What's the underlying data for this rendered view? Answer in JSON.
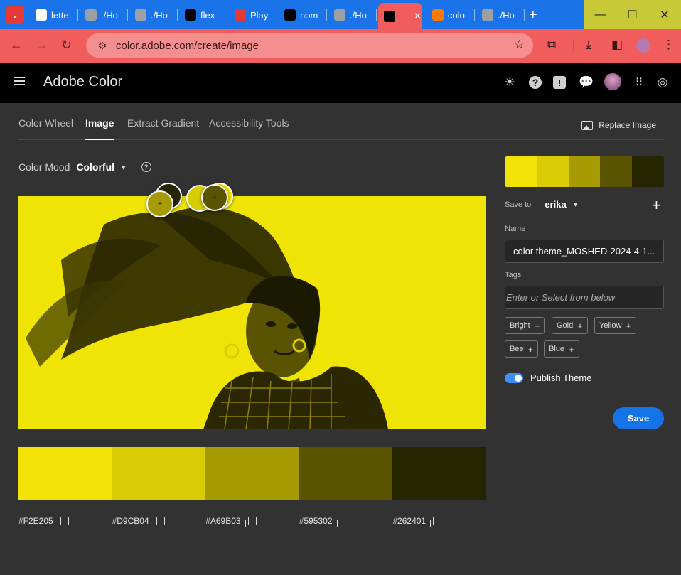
{
  "browser": {
    "tabs": [
      {
        "label": "lette",
        "icon": "lettering-icon",
        "color": "#ffffff"
      },
      {
        "label": "./Ho",
        "icon": "globe-icon",
        "color": "#9aa0a6"
      },
      {
        "label": "./Ho",
        "icon": "globe-icon",
        "color": "#9aa0a6"
      },
      {
        "label": "flex-",
        "icon": "m-letter-icon",
        "color": "#000000"
      },
      {
        "label": "Play",
        "icon": "game-controller-icon",
        "color": "#e53935"
      },
      {
        "label": "nom",
        "icon": "github-icon",
        "color": "#000000"
      },
      {
        "label": "./Ho",
        "icon": "globe-icon",
        "color": "#9aa0a6"
      },
      {
        "label": "",
        "icon": "chatgpt-icon",
        "color": "#000000"
      },
      {
        "label": "colo",
        "icon": "adobe-color-icon",
        "color": "#ff7a00"
      },
      {
        "label": "./Ho",
        "icon": "globe-icon",
        "color": "#9aa0a6"
      }
    ],
    "url": "color.adobe.com/create/image"
  },
  "app": {
    "title": "Adobe Color",
    "nav_tabs": [
      "Color Wheel",
      "Image",
      "Extract Gradient",
      "Accessibility Tools"
    ],
    "active_tab": "Image",
    "replace_image": "Replace Image"
  },
  "mood": {
    "label": "Color Mood",
    "value": "Colorful"
  },
  "theme": {
    "colors": [
      "#F2E205",
      "#D9CB04",
      "#A69B03",
      "#595302",
      "#262401"
    ]
  },
  "panel": {
    "save_to_label": "Save to",
    "library": "erika",
    "name_label": "Name",
    "name_value": "color theme_MOSHED-2024-4-1...",
    "tags_label": "Tags",
    "tags_placeholder": "Enter or Select from below",
    "tags": [
      "Bright",
      "Gold",
      "Yellow",
      "Bee",
      "Blue"
    ],
    "publish_label": "Publish Theme",
    "publish_on": true,
    "save_label": "Save"
  },
  "image": {
    "description_watermark": "@___"
  }
}
